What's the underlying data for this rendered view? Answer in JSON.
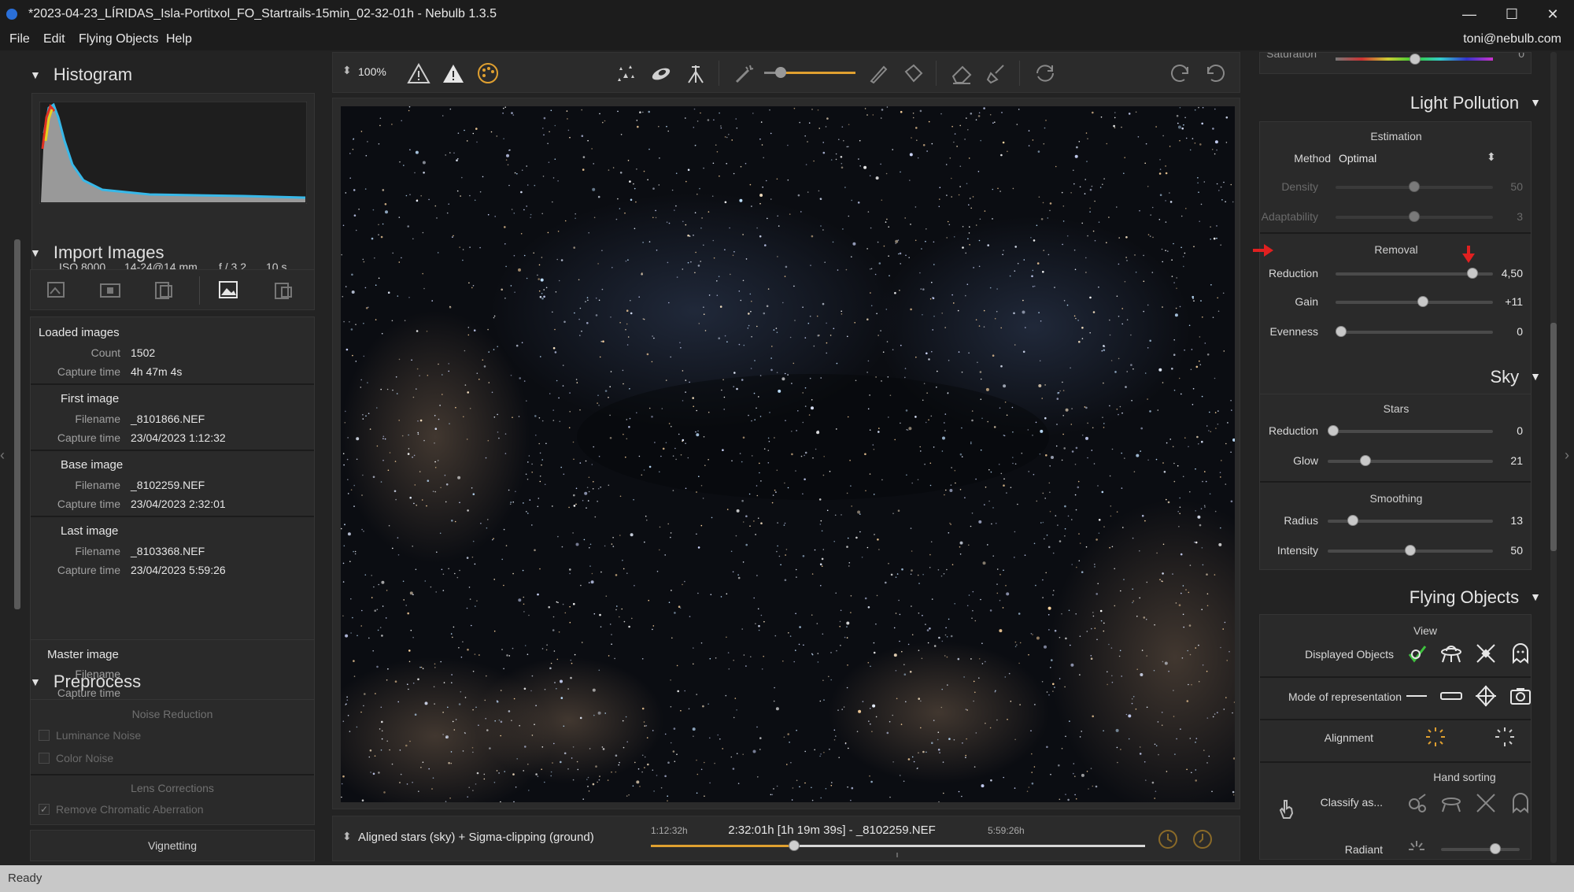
{
  "window": {
    "title": "*2023-04-23_LÍRIDAS_Isla-Portitxol_FO_Startrails-15min_02-32-01h - Nebulb 1.3.5",
    "minimize": "—",
    "maximize": "☐",
    "close": "✕"
  },
  "menu": {
    "items": [
      "File",
      "Edit",
      "Flying Objects",
      "Help"
    ],
    "user": "toni@nebulb.com"
  },
  "status": "Ready",
  "histogram": {
    "title": "Histogram",
    "iso": "ISO 8000",
    "lens": "14-24@14 mm",
    "aperture": "f / 3,2",
    "exposure": "10 s"
  },
  "import": {
    "title": "Import Images",
    "loaded": {
      "heading": "Loaded images",
      "count_label": "Count",
      "count": "1502",
      "capture_label": "Capture time",
      "capture": "4h 47m 4s"
    },
    "first": {
      "heading": "First image",
      "filename_label": "Filename",
      "filename": "_8101866.NEF",
      "capture_label": "Capture time",
      "capture": "23/04/2023 1:12:32"
    },
    "base": {
      "heading": "Base image",
      "filename_label": "Filename",
      "filename": "_8102259.NEF",
      "capture_label": "Capture time",
      "capture": "23/04/2023 2:32:01"
    },
    "last": {
      "heading": "Last image",
      "filename_label": "Filename",
      "filename": "_8103368.NEF",
      "capture_label": "Capture time",
      "capture": "23/04/2023 5:59:26"
    },
    "master": {
      "heading": "Master image",
      "filename_label": "Filename",
      "capture_label": "Capture time"
    }
  },
  "preprocess": {
    "title": "Preprocess",
    "noise_head": "Noise Reduction",
    "luminance": "Luminance Noise",
    "color": "Color Noise",
    "lens_head": "Lens Corrections",
    "chromatic": "Remove Chromatic Aberration",
    "chromatic_checked": true,
    "vignetting": "Vignetting"
  },
  "toolbar": {
    "zoom": "100%",
    "zoom_arrows": "⬍"
  },
  "timeline": {
    "mode": "Aligned stars (sky) + Sigma-clipping (ground)",
    "start": "1:12:32h",
    "current": "2:32:01h [1h 19m 39s] - _8102259.NEF",
    "end": "5:59:26h",
    "position": 0.29
  },
  "right": {
    "saturation_label": "Saturation",
    "saturation_value": "0",
    "light_pollution": {
      "title": "Light Pollution",
      "estimation": "Estimation",
      "method_label": "Method",
      "method_value": "Optimal",
      "density_label": "Density",
      "density_value": "50",
      "density_pos": 0.5,
      "adaptability_label": "Adaptability",
      "adaptability_value": "3",
      "adaptability_pos": 0.5,
      "removal": "Removal",
      "reduction_label": "Reduction",
      "reduction_value": "4,50",
      "reduction_pos": 0.9,
      "gain_label": "Gain",
      "gain_value": "+11",
      "gain_pos": 0.56,
      "evenness_label": "Evenness",
      "evenness_value": "0",
      "evenness_pos": 0.0
    },
    "sky": {
      "title": "Sky",
      "stars": "Stars",
      "reduction_label": "Reduction",
      "reduction_value": "0",
      "reduction_pos": 0.0,
      "glow_label": "Glow",
      "glow_value": "21",
      "glow_pos": 0.21,
      "smoothing": "Smoothing",
      "radius_label": "Radius",
      "radius_value": "13",
      "radius_pos": 0.13,
      "intensity_label": "Intensity",
      "intensity_value": "50",
      "intensity_pos": 0.5
    },
    "flying": {
      "title": "Flying Objects",
      "view": "View",
      "displayed": "Displayed Objects",
      "mode": "Mode of representation",
      "alignment": "Alignment",
      "hand_sorting": "Hand sorting",
      "classify": "Classify as...",
      "radiant": "Radiant"
    }
  },
  "colors": {
    "accent_orange": "#e0a030",
    "annotation_red": "#e02020",
    "green_check": "#3fc33f"
  }
}
